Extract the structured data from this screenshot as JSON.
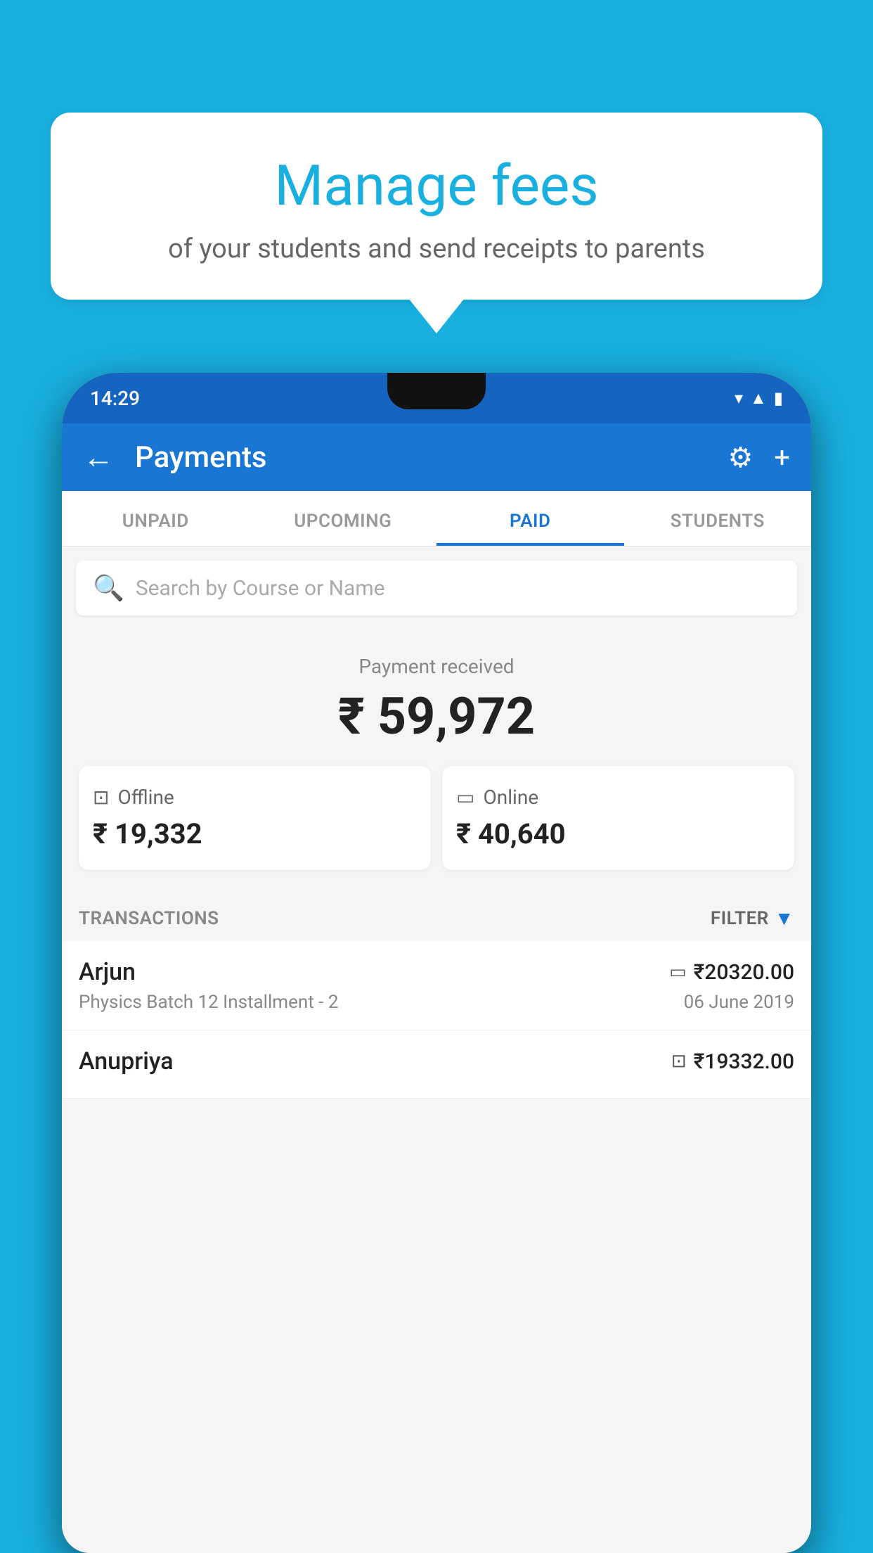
{
  "background_color": "#19B0E0",
  "bubble": {
    "title": "Manage fees",
    "subtitle": "of your students and send receipts to parents"
  },
  "phone": {
    "status_bar": {
      "time": "14:29",
      "icons": [
        "wifi",
        "signal",
        "battery"
      ]
    },
    "app_bar": {
      "title": "Payments",
      "back_label": "←",
      "gear_label": "⚙",
      "plus_label": "+"
    },
    "tabs": [
      {
        "label": "UNPAID",
        "active": false
      },
      {
        "label": "UPCOMING",
        "active": false
      },
      {
        "label": "PAID",
        "active": true
      },
      {
        "label": "STUDENTS",
        "active": false
      }
    ],
    "search": {
      "placeholder": "Search by Course or Name"
    },
    "payment_summary": {
      "label": "Payment received",
      "total": "₹ 59,972",
      "offline_label": "Offline",
      "offline_amount": "₹ 19,332",
      "online_label": "Online",
      "online_amount": "₹ 40,640"
    },
    "transactions": {
      "header_label": "TRANSACTIONS",
      "filter_label": "FILTER",
      "rows": [
        {
          "name": "Arjun",
          "course": "Physics Batch 12 Installment - 2",
          "amount": "₹20320.00",
          "date": "06 June 2019",
          "type": "online"
        },
        {
          "name": "Anupriya",
          "course": "",
          "amount": "₹19332.00",
          "date": "",
          "type": "offline"
        }
      ]
    }
  }
}
